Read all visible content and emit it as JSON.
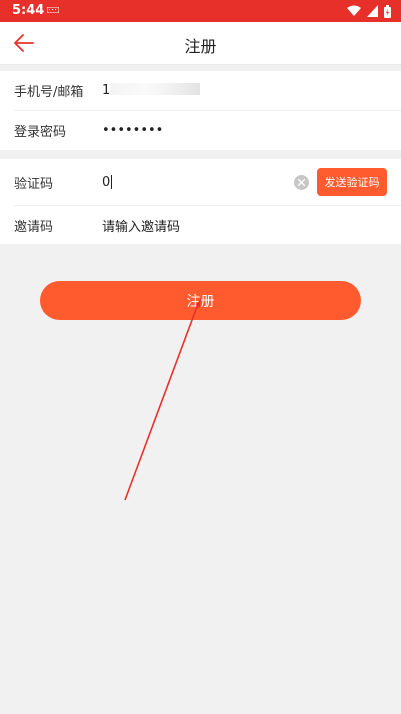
{
  "status_bar": {
    "time": "5:44"
  },
  "header": {
    "title": "注册"
  },
  "form": {
    "account": {
      "label": "手机号/邮箱",
      "value": "1"
    },
    "password": {
      "label": "登录密码",
      "value": "••••••••"
    },
    "verification": {
      "label": "验证码",
      "value": "0",
      "send_button": "发送验证码"
    },
    "invite": {
      "label": "邀请码",
      "placeholder": "请输入邀请码"
    }
  },
  "actions": {
    "register_label": "注册"
  },
  "colors": {
    "status_bar": "#e8302a",
    "accent": "#ff5b2f",
    "background": "#f1f1f1"
  },
  "icons": [
    "back-arrow-icon",
    "wifi-icon",
    "signal-icon",
    "battery-icon",
    "keyboard-icon",
    "clear-icon"
  ]
}
